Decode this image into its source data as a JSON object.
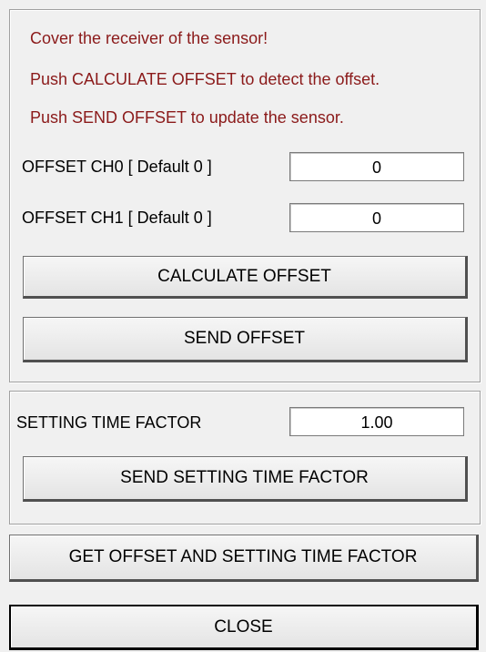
{
  "offset_panel": {
    "instructions": [
      "Cover the receiver of the sensor!",
      "Push CALCULATE OFFSET to detect the offset.",
      "Push SEND OFFSET to update the sensor."
    ],
    "ch0_label": "OFFSET CH0 [ Default 0 ]",
    "ch0_value": "0",
    "ch1_label": "OFFSET CH1 [ Default 0 ]",
    "ch1_value": "0",
    "calculate_label": "CALCULATE OFFSET",
    "send_label": "SEND OFFSET"
  },
  "time_panel": {
    "label": "SETTING TIME FACTOR",
    "value": "1.00",
    "send_label": "SEND SETTING TIME FACTOR"
  },
  "get_label": "GET OFFSET AND SETTING TIME FACTOR",
  "close_label": "CLOSE",
  "colors": {
    "instruction_text": "#8b1a1a",
    "background": "#f0f0f0"
  }
}
